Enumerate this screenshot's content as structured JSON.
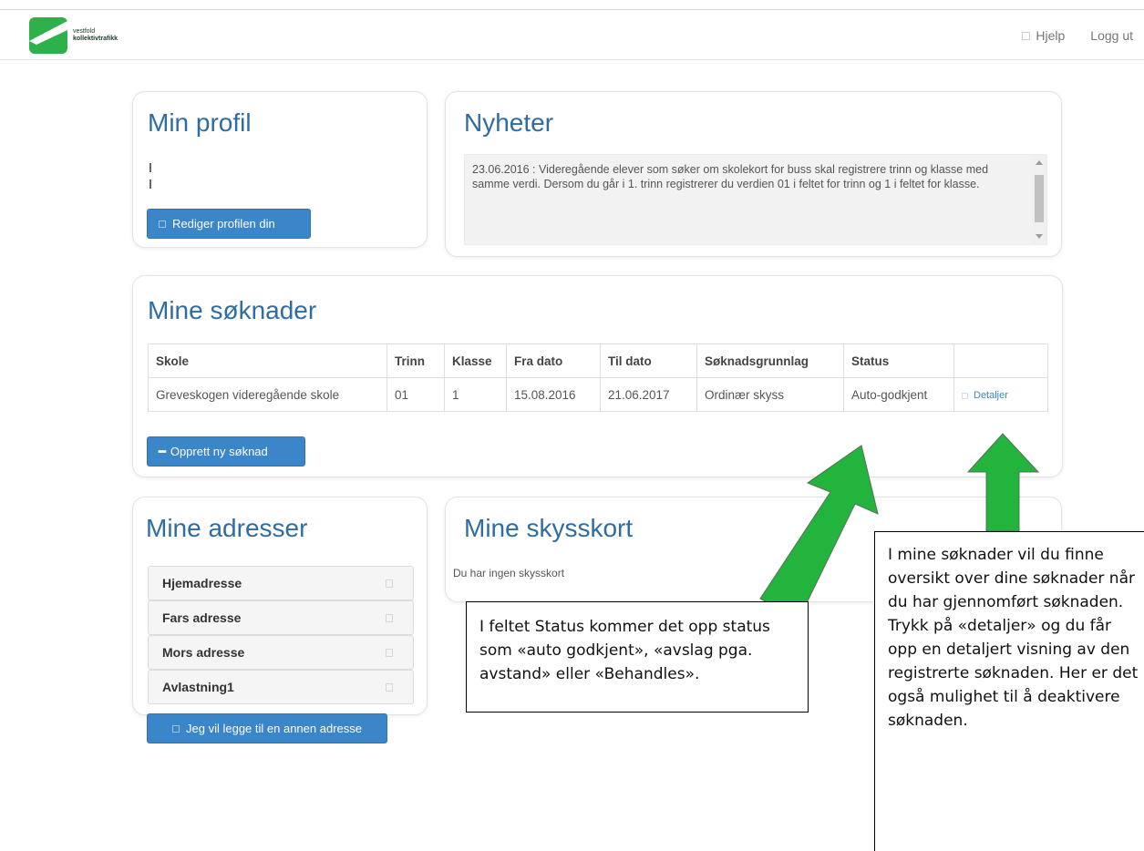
{
  "brand": {
    "line1": "vestfold",
    "line2": "kollektivtrafikk",
    "color": "#2eb04a"
  },
  "nav": {
    "help": "Hjelp",
    "logout": "Logg ut"
  },
  "profile": {
    "title": "Min profil",
    "edit_button": "Rediger profilen din"
  },
  "news": {
    "title": "Nyheter",
    "text": "23.06.2016 : Videregående elever som søker om skolekort for buss skal registrere trinn og klasse med samme verdi. Dersom du går i 1. trinn registrerer du verdien 01 i feltet for trinn og 1 i feltet for klasse."
  },
  "applications": {
    "title": "Mine søknader",
    "columns": [
      "Skole",
      "Trinn",
      "Klasse",
      "Fra dato",
      "Til dato",
      "Søknadsgrunnlag",
      "Status",
      ""
    ],
    "rows": [
      [
        "Greveskogen videregående skole",
        "01",
        "1",
        "15.08.2016",
        "21.06.2017",
        "Ordinær skyss",
        "Auto-godkjent"
      ]
    ],
    "details_link": "Detaljer",
    "new_button": "Opprett ny søknad"
  },
  "addresses": {
    "title": "Mine adresser",
    "items": [
      "Hjemadresse",
      "Fars adresse",
      "Mors adresse",
      "Avlastning1"
    ],
    "add_button": "Jeg vil legge til en annen adresse"
  },
  "travel_cards": {
    "title": "Mine skysskort",
    "empty_text": "Du har ingen skysskort"
  },
  "callouts": {
    "status": "I feltet Status kommer det opp status som «auto godkjent», «avslag pga. avstand» eller «Behandles».",
    "details": "I mine søknader vil du finne oversikt over dine søknader når du har gjennomført søknaden. Trykk på «detaljer» og du får opp en detaljert visning av den registrerte søknaden. Her er det også mulighet til å deaktivere søknaden."
  },
  "colors": {
    "accent": "#2e6da4",
    "button": "#3a86c8",
    "arrow": "#22b43c"
  }
}
